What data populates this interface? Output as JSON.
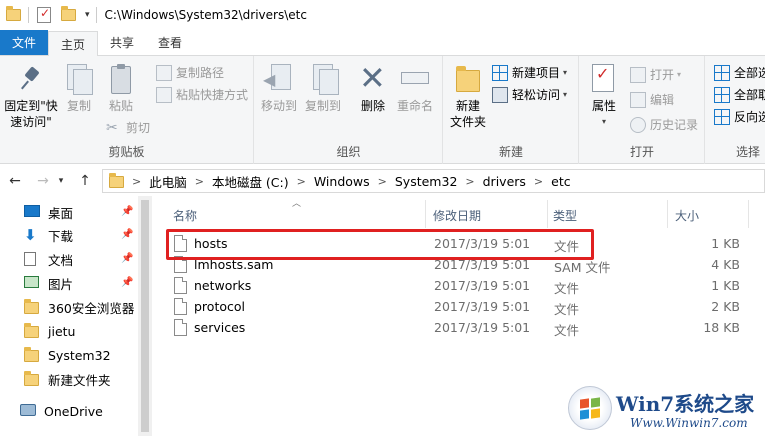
{
  "titlebar": {
    "path": "C:\\Windows\\System32\\drivers\\etc",
    "dropdown": "▾"
  },
  "tabs": [
    {
      "label": "文件",
      "active": false
    },
    {
      "label": "主页",
      "active": true
    },
    {
      "label": "共享",
      "active": false
    },
    {
      "label": "查看",
      "active": false
    }
  ],
  "ribbon": {
    "clipboard": {
      "label": "剪贴板",
      "pin": "固定到\"快速访问\"",
      "pin_line1": "固定到\"快",
      "pin_line2": "速访问\"",
      "copy": "复制",
      "paste": "粘贴",
      "copy_path": "复制路径",
      "paste_shortcut": "粘贴快捷方式",
      "cut": "剪切"
    },
    "organize": {
      "label": "组织",
      "move_to": "移动到",
      "copy_to": "复制到",
      "delete": "删除",
      "rename": "重命名"
    },
    "new": {
      "label": "新建",
      "new_folder_line1": "新建",
      "new_folder_line2": "文件夹",
      "new_item": "新建项目",
      "easy_access": "轻松访问"
    },
    "open": {
      "label": "打开",
      "properties": "属性",
      "open": "打开",
      "edit": "编辑",
      "history": "历史记录"
    },
    "select": {
      "label": "选择",
      "select_all": "全部选",
      "select_none": "全部取",
      "invert": "反向选"
    }
  },
  "address": {
    "crumbs": [
      "此电脑",
      "本地磁盘 (C:)",
      "Windows",
      "System32",
      "drivers",
      "etc"
    ],
    "separator": ">"
  },
  "nav": {
    "items": [
      {
        "label": "桌面",
        "icon": "desktop-icon",
        "pinned": true
      },
      {
        "label": "下载",
        "icon": "download-icon",
        "pinned": true
      },
      {
        "label": "文档",
        "icon": "document-icon",
        "pinned": true
      },
      {
        "label": "图片",
        "icon": "picture-icon",
        "pinned": true
      },
      {
        "label": "360安全浏览器",
        "icon": "folder-icon",
        "pinned": false
      },
      {
        "label": "jietu",
        "icon": "folder-icon",
        "pinned": false
      },
      {
        "label": "System32",
        "icon": "folder-icon",
        "pinned": false
      },
      {
        "label": "新建文件夹",
        "icon": "folder-icon",
        "pinned": false
      }
    ],
    "onedrive": "OneDrive"
  },
  "list": {
    "columns": {
      "name": "名称",
      "date": "修改日期",
      "type": "类型",
      "size": "大小"
    },
    "rows": [
      {
        "name": "hosts",
        "date": "2017/3/19 5:01",
        "type": "文件",
        "size": "1 KB"
      },
      {
        "name": "lmhosts.sam",
        "date": "2017/3/19 5:01",
        "type": "SAM 文件",
        "size": "4 KB"
      },
      {
        "name": "networks",
        "date": "2017/3/19 5:01",
        "type": "文件",
        "size": "1 KB"
      },
      {
        "name": "protocol",
        "date": "2017/3/19 5:01",
        "type": "文件",
        "size": "2 KB"
      },
      {
        "name": "services",
        "date": "2017/3/19 5:01",
        "type": "文件",
        "size": "18 KB"
      }
    ]
  },
  "watermark": {
    "title": "Win7系统之家",
    "url": "Www.Winwin7.com"
  },
  "colors": {
    "accent": "#1979ca",
    "highlight": "#e02020"
  }
}
